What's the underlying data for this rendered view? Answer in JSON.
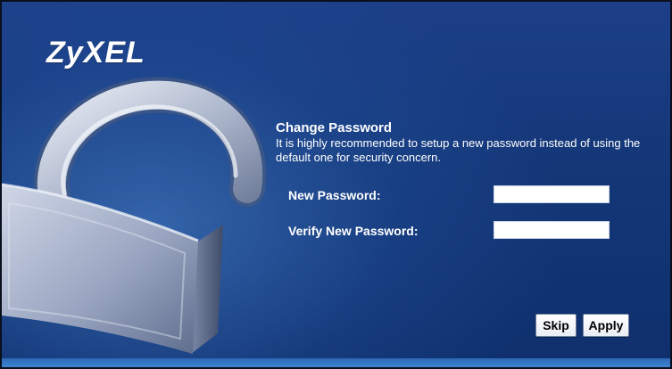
{
  "brand": {
    "logo_text": "ZyXEL"
  },
  "form": {
    "title": "Change Password",
    "description": "It is highly recommended to setup a new password instead of using the default one for security concern.",
    "new_password_label": "New Password:",
    "new_password_value": "",
    "verify_password_label": "Verify New Password:",
    "verify_password_value": ""
  },
  "buttons": {
    "skip_label": "Skip",
    "apply_label": "Apply"
  },
  "colors": {
    "background": "#163a7c",
    "accent_bar": "#3f86d3",
    "text": "#ffffff"
  },
  "icons": {
    "lock": "padlock-illustration"
  }
}
